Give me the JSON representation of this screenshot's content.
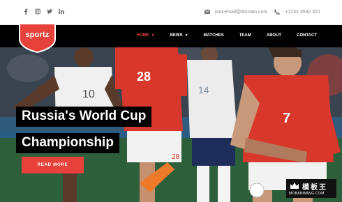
{
  "topbar": {
    "social_icons": [
      "facebook-icon",
      "instagram-icon",
      "twitter-icon",
      "linkedin-icon"
    ],
    "email": "youremail@domain.com",
    "phone": "+1232 3532 321"
  },
  "brand": {
    "logo_text": "sportz",
    "accent_color": "#e7413b"
  },
  "nav": {
    "items": [
      {
        "label": "HOME",
        "dropdown": true,
        "active": true
      },
      {
        "label": "NEWS",
        "dropdown": true,
        "active": false
      },
      {
        "label": "MATCHES",
        "dropdown": false,
        "active": false
      },
      {
        "label": "TEAM",
        "dropdown": false,
        "active": false
      },
      {
        "label": "ABOUT",
        "dropdown": false,
        "active": false
      },
      {
        "label": "CONTACT",
        "dropdown": false,
        "active": false
      }
    ]
  },
  "hero": {
    "title_line1": "Russia's World Cup",
    "title_line2": "Championship",
    "button_label": "READ MORE",
    "jersey_numbers": [
      "10",
      "28",
      "14",
      "7",
      "28"
    ]
  },
  "watermark": {
    "chinese": "模板王",
    "latin": "MOBANWANG.COM"
  }
}
